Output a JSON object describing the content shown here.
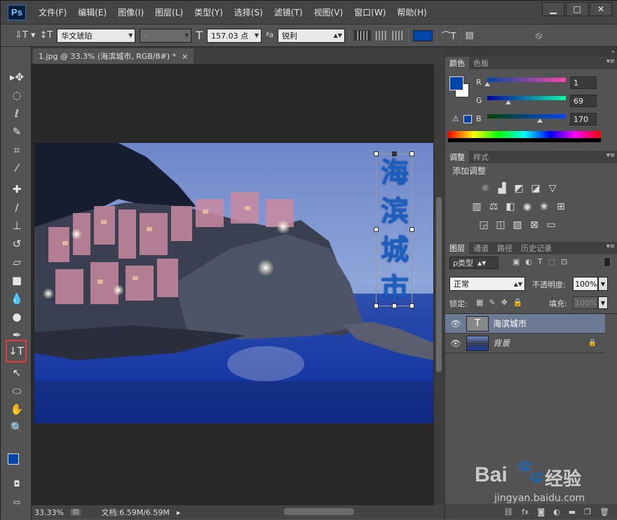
{
  "app": {
    "logo": "Ps"
  },
  "menu": [
    "文件(F)",
    "编辑(E)",
    "图像(I)",
    "图层(L)",
    "类型(Y)",
    "选择(S)",
    "滤镜(T)",
    "视图(V)",
    "窗口(W)",
    "帮助(H)"
  ],
  "window_controls": [
    "▁",
    "□",
    "✕"
  ],
  "options": {
    "font_family": "华文琥珀",
    "font_style": "-",
    "font_size": "157.03 点",
    "anti_alias": "锐利",
    "text_color": "#0145aa"
  },
  "document": {
    "tab_title": "1.jpg @ 33.3% (海滨城市, RGB/8#) *",
    "close": "×"
  },
  "status": {
    "zoom": "33.33%",
    "doc_size": "文档:6.59M/6.59M"
  },
  "canvas_text": [
    "海",
    "滨",
    "城",
    "市"
  ],
  "color_panel": {
    "tabs": [
      "颜色",
      "色板"
    ],
    "r_label": "R",
    "g_label": "G",
    "b_label": "B",
    "r": "1",
    "g": "69",
    "b": "170",
    "r_fraction": 0.004,
    "g_fraction": 0.27,
    "b_fraction": 0.667,
    "fg_color": "#0145aa",
    "bg_color": "#ffffff"
  },
  "adjust_panel": {
    "tabs": [
      "调整",
      "样式"
    ],
    "title": "添加调整"
  },
  "layers_panel": {
    "tabs": [
      "图层",
      "通道",
      "路径",
      "历史记录"
    ],
    "filter_label": "ρ类型",
    "blend_mode": "正常",
    "opacity_label": "不透明度:",
    "opacity_value": "100%",
    "lock_label": "锁定:",
    "fill_label": "填充:",
    "fill_value": "100%",
    "layers": [
      {
        "name": "海滨城市",
        "thumb": "T"
      },
      {
        "name": "背景",
        "locked": "🔒"
      }
    ]
  },
  "watermark": {
    "brand": "Bai",
    "brand2": "经验",
    "url": "jingyan.baidu.com"
  }
}
